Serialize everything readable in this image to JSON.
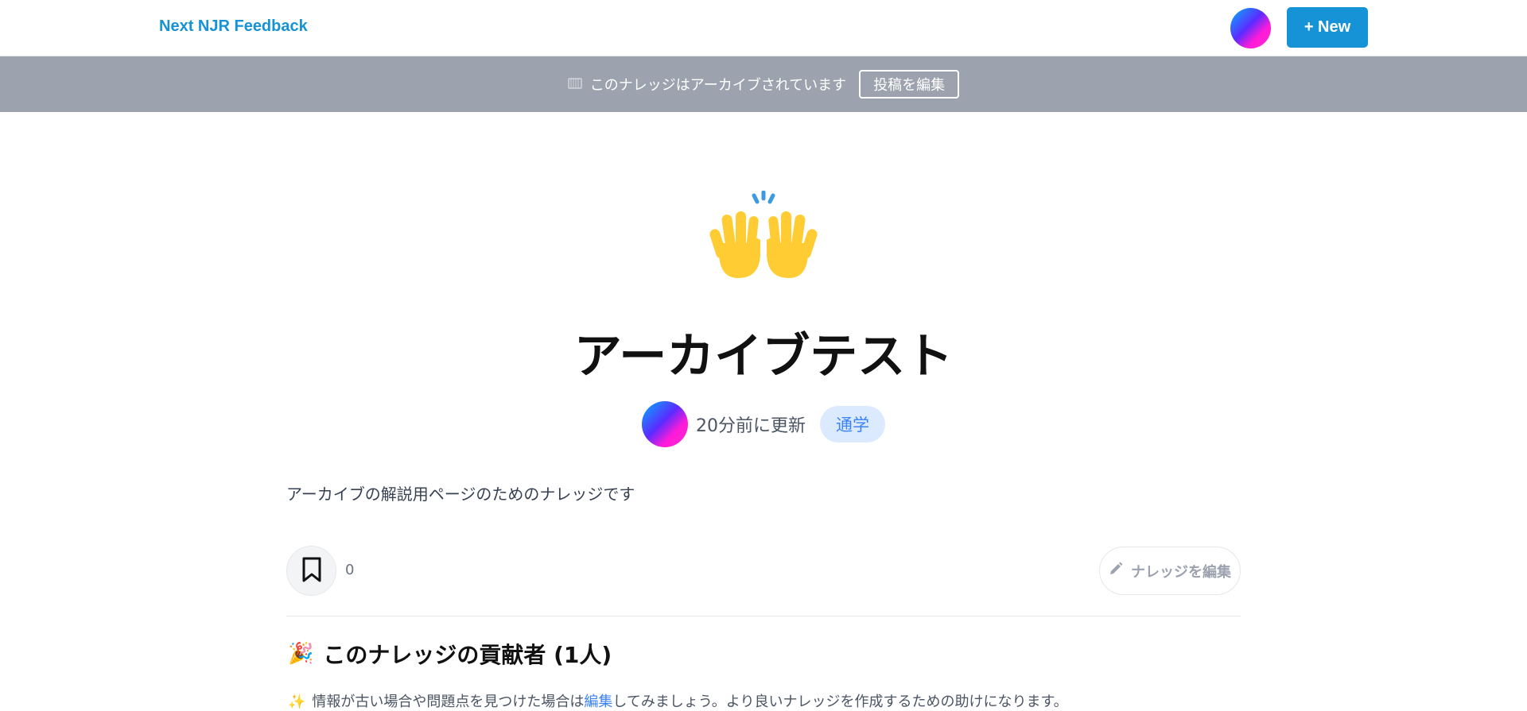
{
  "header": {
    "brand": "Next NJR Feedback",
    "new_button_label": "+ New"
  },
  "banner": {
    "icon": "archive-box-icon",
    "text": "このナレッジはアーカイブされています",
    "edit_post_label": "投稿を編集"
  },
  "hero": {
    "emoji": "raising-hands-icon",
    "title": "アーカイブテスト",
    "updated": "20分前に更新",
    "tag": "通学"
  },
  "description": "アーカイブの解説用ページのためのナレッジです",
  "actions": {
    "bookmark_count": "0",
    "edit_knowledge_label": "ナレッジを編集"
  },
  "contributors": {
    "title": "このナレッジの貢献者 (1人)",
    "note_before": "情報が古い場合や問題点を見つけた場合は",
    "note_link": "編集",
    "note_after": "してみましょう。より良いナレッジを作成するための助けになります。"
  },
  "colors": {
    "brand": "#1593d6",
    "banner_bg": "#9ca3ae",
    "tag_bg": "#dbeafe",
    "tag_text": "#3b82f6"
  }
}
